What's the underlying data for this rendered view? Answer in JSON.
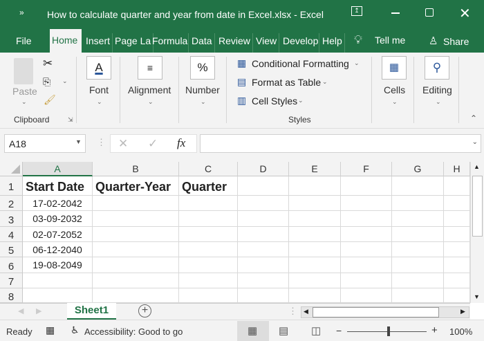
{
  "title_bar": {
    "title": "How to calculate quarter and year from date in Excel.xlsx  -  Excel",
    "qat_icon": "more-icon"
  },
  "tabs": [
    {
      "label": "File"
    },
    {
      "label": "Home",
      "active": true
    },
    {
      "label": "Insert"
    },
    {
      "label": "Page La"
    },
    {
      "label": "Formula"
    },
    {
      "label": "Data"
    },
    {
      "label": "Review"
    },
    {
      "label": "View"
    },
    {
      "label": "Develop"
    },
    {
      "label": "Help"
    }
  ],
  "tell_me": "Tell me",
  "share": "Share",
  "ribbon": {
    "paste": "Paste",
    "clipboard": "Clipboard",
    "font": "Font",
    "alignment": "Alignment",
    "number": "Number",
    "conditional_formatting": "Conditional Formatting",
    "format_as_table": "Format as Table",
    "cell_styles": "Cell Styles",
    "styles": "Styles",
    "cells": "Cells",
    "editing": "Editing"
  },
  "formula_bar": {
    "name_box": "A18",
    "formula": "",
    "fx": "fx"
  },
  "columns": [
    "A",
    "B",
    "C",
    "D",
    "E",
    "F",
    "G",
    "H"
  ],
  "rows": [
    "1",
    "2",
    "3",
    "4",
    "5",
    "6",
    "7",
    "8"
  ],
  "cells": {
    "A1": "Start Date",
    "B1": "Quarter-Year",
    "C1": "Quarter",
    "A2": "17-02-2042",
    "A3": "03-09-2032",
    "A4": "02-07-2052",
    "A5": "06-12-2040",
    "A6": "19-08-2049"
  },
  "sheets": [
    {
      "label": "Sheet1",
      "active": true
    }
  ],
  "status": {
    "ready": "Ready",
    "accessibility": "Accessibility: Good to go",
    "zoom": "100%"
  },
  "colors": {
    "brand": "#217346"
  }
}
